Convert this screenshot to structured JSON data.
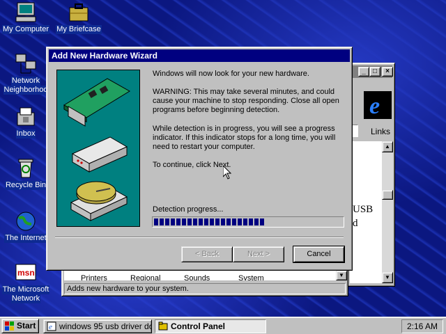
{
  "desktop": {
    "icons": [
      {
        "label": "My Computer",
        "icon": "my-computer-icon"
      },
      {
        "label": "My Briefcase",
        "icon": "briefcase-icon"
      },
      {
        "label": "Network",
        "icon": "network-neighborhood-icon"
      },
      {
        "label": "Neighborhoo",
        "icon": ""
      },
      {
        "label": "Inbox",
        "icon": "inbox-icon"
      },
      {
        "label": "Recycle Bin",
        "icon": "recycle-bin-icon"
      },
      {
        "label": "The Internet",
        "icon": "internet-icon"
      },
      {
        "label": "The Microsoft",
        "icon": "msn-icon"
      },
      {
        "label": "Network",
        "icon": ""
      }
    ]
  },
  "ie_window": {
    "links_label": "Links",
    "content_line1": "USB",
    "content_line2": "d"
  },
  "control_panel": {
    "items": [
      "Printers",
      "Regional",
      "Sounds",
      "System"
    ],
    "status": "Adds new hardware to your system."
  },
  "wizard": {
    "title": "Add New Hardware Wizard",
    "intro": "Windows will now look for your new hardware.",
    "warning": "WARNING: This may take several minutes, and could cause your machine to stop responding. Close all open programs before beginning detection.",
    "detection_info": "While detection is in progress, you will see a progress indicator. If this indicator stops for a long time, you will need to restart your computer.",
    "continue": "To continue, click Next.",
    "progress_label": "Detection progress...",
    "progress_fraction": 0.6,
    "buttons": {
      "back": "< Back",
      "next": "Next >",
      "cancel": "Cancel"
    }
  },
  "taskbar": {
    "start": "Start",
    "tasks": [
      {
        "label": "windows 95 usb driver do...",
        "icon": "ie-page-icon",
        "active": false
      },
      {
        "label": "Control Panel",
        "icon": "folder-icon",
        "active": true
      }
    ],
    "clock": "2:16 AM"
  },
  "colors": {
    "titlebar": "#000080",
    "face": "#c0c0c0",
    "progress": "#000080",
    "wizard_art": "#008080"
  }
}
